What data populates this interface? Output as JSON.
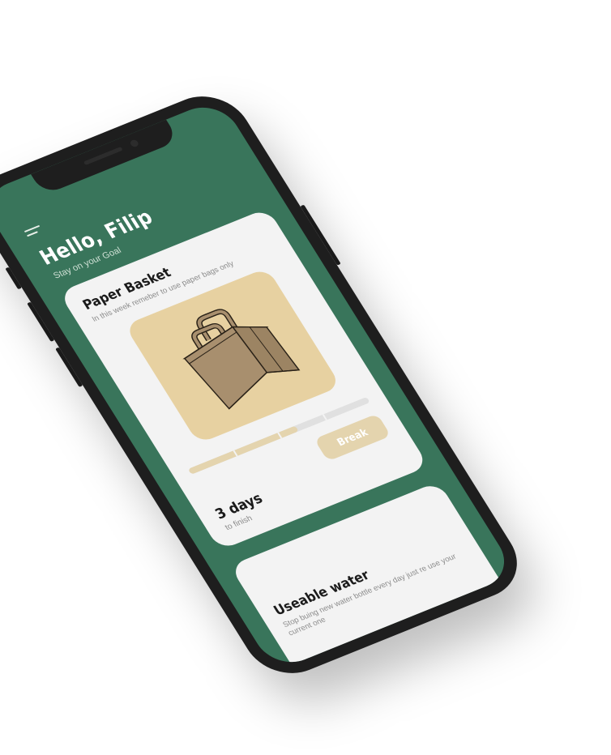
{
  "header": {
    "greeting": "Hello, Filip",
    "subtitle": "Stay on your Goal"
  },
  "challenges": [
    {
      "title": "Paper Basket",
      "description": "In this week remeber to use paper bags only",
      "illustration": "paper-bag",
      "progress": 0.6,
      "progress_segments": 4,
      "days_value": "3 days",
      "days_label": "to finish",
      "action_label": "Break"
    },
    {
      "title": "Useable water",
      "description": "Stop buing new water bottle every day just re use your current one"
    }
  ],
  "colors": {
    "screen_bg": "#39755b",
    "card_bg": "#f3f3f3",
    "accent": "#e4d4ae",
    "illustration_bg": "#e7d1a1",
    "bag": "#a88f6e",
    "phone_frame": "#1e1e1e"
  },
  "icons": {
    "menu": "menu-icon"
  }
}
